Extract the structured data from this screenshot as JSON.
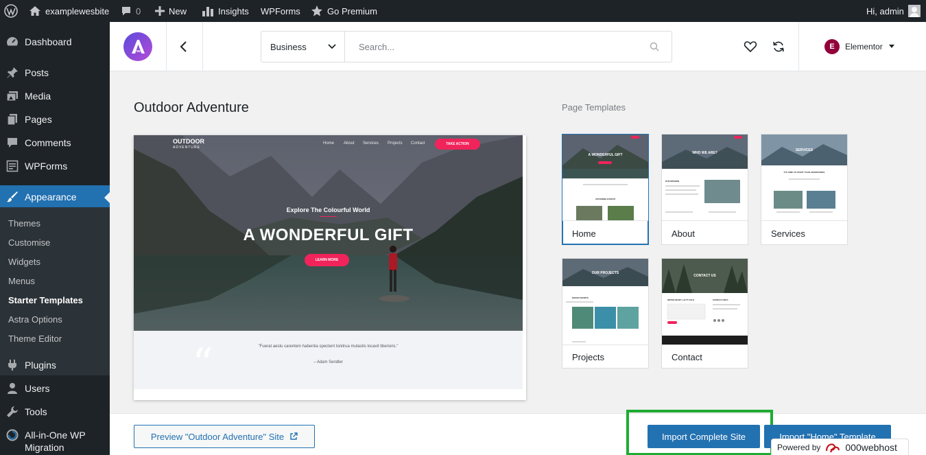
{
  "adminbar": {
    "site_name": "examplewesbite",
    "comments_count": "0",
    "new_label": "New",
    "insights_label": "Insights",
    "wpforms_label": "WPForms",
    "go_premium_label": "Go Premium",
    "greeting": "Hi, admin"
  },
  "sidebar": {
    "items": [
      {
        "label": "Dashboard",
        "icon": "dashboard-icon"
      },
      {
        "label": "Posts",
        "icon": "pin-icon"
      },
      {
        "label": "Media",
        "icon": "media-icon"
      },
      {
        "label": "Pages",
        "icon": "pages-icon"
      },
      {
        "label": "Comments",
        "icon": "comment-icon"
      },
      {
        "label": "WPForms",
        "icon": "form-icon"
      },
      {
        "label": "Appearance",
        "icon": "brush-icon"
      },
      {
        "label": "Plugins",
        "icon": "plug-icon"
      },
      {
        "label": "Users",
        "icon": "user-icon"
      },
      {
        "label": "Tools",
        "icon": "wrench-icon"
      },
      {
        "label": "All-in-One WP",
        "label2": "Migration",
        "icon": "migration-icon"
      }
    ],
    "submenu": [
      "Themes",
      "Customise",
      "Widgets",
      "Menus",
      "Starter Templates",
      "Astra Options",
      "Theme Editor"
    ]
  },
  "header": {
    "category": "Business",
    "search_placeholder": "Search...",
    "builder": "Elementor",
    "builder_badge": "E"
  },
  "main": {
    "site_title": "Outdoor Adventure",
    "page_templates_title": "Page Templates",
    "preview": {
      "logo_line1": "OUTDOOR",
      "logo_line2": "ADVENTURE",
      "nav": [
        "Home",
        "About",
        "Services",
        "Projects",
        "Contact"
      ],
      "nav_cta": "TAKE ACTION",
      "subheading": "Explore The Colourful World",
      "heading": "A WONDERFUL GIFT",
      "hero_cta": "LEARN MORE",
      "quote": "\"Fuerat aestu carentem habentia spectent tonitrua mutastis locavit liberioris.\"",
      "quote_author": "– Adam Sendler"
    },
    "templates": [
      {
        "name": "Home",
        "selected": true,
        "thumb_heading": "A WONDERFUL GIFT",
        "thumb_sub": "UPCOMING EVENTS"
      },
      {
        "name": "About",
        "selected": false,
        "thumb_heading": "WHO WE ARE?",
        "thumb_sub": "OUR MISSION"
      },
      {
        "name": "Services",
        "selected": false,
        "thumb_heading": "SERVICES",
        "thumb_sub": "IT'S TIME TO START YOUR ADVENTURES"
      },
      {
        "name": "Projects",
        "selected": false,
        "thumb_heading": "OUR PROJECTS",
        "thumb_sub": "WATER SPORTS"
      },
      {
        "name": "Contact",
        "selected": false,
        "thumb_heading": "CONTACT US",
        "thumb_sub": "WE'RE READY, LET'S TALK",
        "thumb_sub2": "CONTACT INFO"
      }
    ]
  },
  "bottom": {
    "preview_label": "Preview \"Outdoor Adventure\" Site",
    "import_site_label": "Import Complete Site",
    "import_template_label": "Import \"Home\" Template",
    "powered_by": "Powered by",
    "powered_brand": "000webhost"
  },
  "colors": {
    "accent": "#2271b1",
    "admin_bg": "#1d2327",
    "highlight": "#1fab32",
    "cta_pink": "#f0245b"
  }
}
